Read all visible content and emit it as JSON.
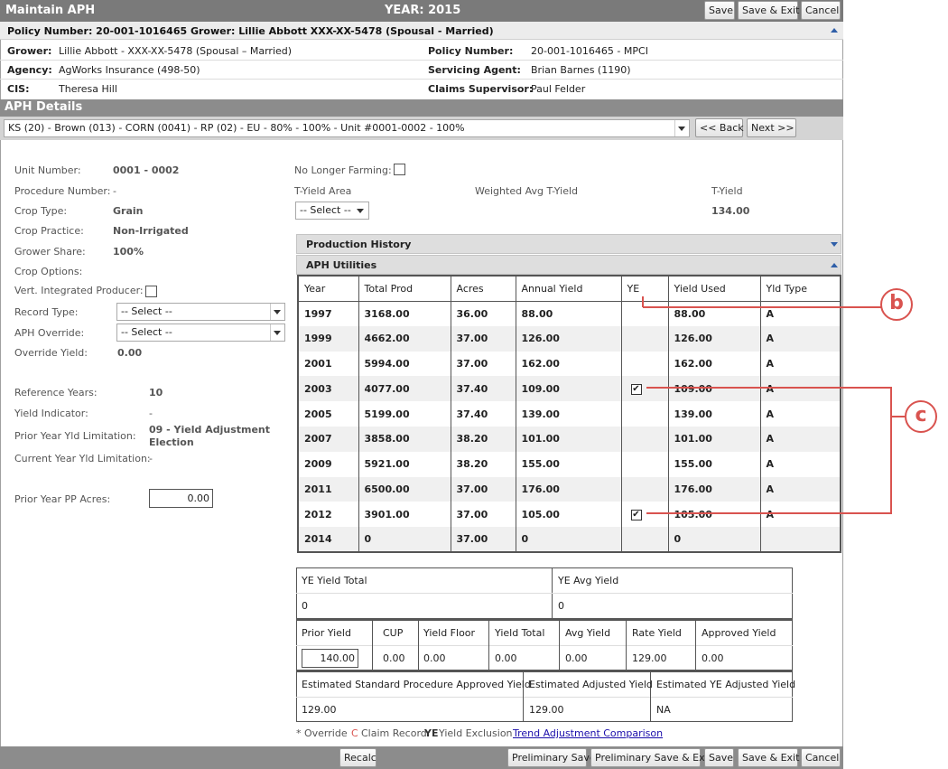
{
  "header": {
    "title": "Maintain APH",
    "year": "YEAR: 2015",
    "buttons": {
      "save": "Save",
      "save_exit": "Save & Exit",
      "cancel": "Cancel"
    }
  },
  "policy_bar": "Policy Number: 20-001-1016465 Grower: Lillie Abbott XXX-XX-5478 (Spousal - Married)",
  "info": {
    "grower_label": "Grower:",
    "grower": "Lillie Abbott - XXX-XX-5478 (Spousal – Married)",
    "agency_label": "Agency:",
    "agency": "AgWorks Insurance (498-50)",
    "cis_label": "CIS:",
    "cis": "Theresa Hill",
    "policy_label": "Policy Number:",
    "policy": "20-001-1016465 - MPCI",
    "agent_label": "Servicing Agent:",
    "agent": "Brian Barnes (1190)",
    "claims_label": "Claims Supervisor:",
    "claims": "Paul Felder"
  },
  "aph": {
    "section_title": "APH Details",
    "unit_select": "KS (20) - Brown (013) - CORN (0041) - RP (02) - EU - 80% - 100% - Unit #0001-0002 - 100%",
    "back": "<< Back",
    "next": "Next >>"
  },
  "left": {
    "unit_number_label": "Unit Number:",
    "unit_number": "0001 - 0002",
    "procedure_label": "Procedure Number:",
    "procedure": "-",
    "crop_type_label": "Crop Type:",
    "crop_type": "Grain",
    "crop_practice_label": "Crop Practice:",
    "crop_practice": "Non-Irrigated",
    "grower_share_label": "Grower Share:",
    "grower_share": "100%",
    "crop_options_label": "Crop Options:",
    "vert_label": "Vert. Integrated Producer:",
    "record_type_label": "Record Type:",
    "record_type": "-- Select --",
    "aph_override_label": "APH Override:",
    "aph_override": "-- Select --",
    "override_yield_label": "Override Yield:",
    "override_yield": "0.00",
    "ref_years_label": "Reference Years:",
    "ref_years": "10",
    "yield_ind_label": "Yield Indicator:",
    "yield_ind": "-",
    "prior_lim_label": "Prior Year Yld Limitation:",
    "prior_lim_1": "09 - Yield Adjustment",
    "prior_lim_2": "Election",
    "current_lim_label": "Current Year Yld Limitation:",
    "current_lim": "-",
    "pp_acres_label": "Prior Year PP Acres:",
    "pp_acres": "0.00"
  },
  "middle": {
    "no_longer_label": "No Longer Farming:",
    "tyield_area_label": "T-Yield Area",
    "tyield_area": "-- Select --",
    "weighted_label": "Weighted Avg T-Yield",
    "tyield_label": "T-Yield",
    "tyield": "134.00",
    "production_history": "Production History",
    "aph_utilities": "APH Utilities"
  },
  "yield_table": {
    "headers": [
      "Year",
      "Total Prod",
      "Acres",
      "Annual Yield",
      "YE",
      "Yield Used",
      "Yld Type"
    ],
    "rows": [
      {
        "year": "1997",
        "prod": "3168.00",
        "acres": "36.00",
        "annual": "88.00",
        "ye": false,
        "used": "88.00",
        "type": "A"
      },
      {
        "year": "1999",
        "prod": "4662.00",
        "acres": "37.00",
        "annual": "126.00",
        "ye": false,
        "used": "126.00",
        "type": "A"
      },
      {
        "year": "2001",
        "prod": "5994.00",
        "acres": "37.00",
        "annual": "162.00",
        "ye": false,
        "used": "162.00",
        "type": "A"
      },
      {
        "year": "2003",
        "prod": "4077.00",
        "acres": "37.40",
        "annual": "109.00",
        "ye": true,
        "used": "109.00",
        "type": "A"
      },
      {
        "year": "2005",
        "prod": "5199.00",
        "acres": "37.40",
        "annual": "139.00",
        "ye": false,
        "used": "139.00",
        "type": "A"
      },
      {
        "year": "2007",
        "prod": "3858.00",
        "acres": "38.20",
        "annual": "101.00",
        "ye": false,
        "used": "101.00",
        "type": "A"
      },
      {
        "year": "2009",
        "prod": "5921.00",
        "acres": "38.20",
        "annual": "155.00",
        "ye": false,
        "used": "155.00",
        "type": "A"
      },
      {
        "year": "2011",
        "prod": "6500.00",
        "acres": "37.00",
        "annual": "176.00",
        "ye": false,
        "used": "176.00",
        "type": "A"
      },
      {
        "year": "2012",
        "prod": "3901.00",
        "acres": "37.00",
        "annual": "105.00",
        "ye": true,
        "used": "105.00",
        "type": "A"
      },
      {
        "year": "2014",
        "prod": "0",
        "acres": "37.00",
        "annual": "0",
        "ye": false,
        "used": "0",
        "type": ""
      }
    ]
  },
  "summary": {
    "ye_total_label": "YE Yield Total",
    "ye_total": "0",
    "ye_avg_label": "YE Avg Yield",
    "ye_avg": "0",
    "prior_yield_label": "Prior Yield",
    "prior_yield": "140.00",
    "cup_label": "CUP",
    "cup": "0.00",
    "floor_label": "Yield Floor",
    "floor": "0.00",
    "yield_total_label": "Yield Total",
    "yield_total": "0.00",
    "avg_yield_label": "Avg Yield",
    "avg_yield": "0.00",
    "rate_yield_label": "Rate Yield",
    "rate_yield": "129.00",
    "approved_label": "Approved Yield",
    "approved": "0.00",
    "est_std_label": "Estimated Standard Procedure Approved Yield",
    "est_std": "129.00",
    "est_adj_label": "Estimated Adjusted Yield",
    "est_adj": "129.00",
    "est_ye_label": "Estimated YE Adjusted Yield",
    "est_ye": "NA"
  },
  "legend": {
    "override": "* Override",
    "claim_c": "C",
    "claim": "Claim Record",
    "ye_tag": "YE",
    "ye": "Yield Exclusion",
    "trend_link": "Trend Adjustment Comparison"
  },
  "footer": {
    "recalc": "Recalc",
    "prelim_save": "Preliminary Save",
    "prelim_save_exit": "Preliminary Save & Exit",
    "save": "Save",
    "save_exit": "Save & Exit",
    "cancel": "Cancel"
  },
  "callouts": {
    "b": "b",
    "c": "c"
  },
  "colors": {
    "callout": "#d9534f",
    "header_bg": "#7a7a7a",
    "link": "#1a0dab"
  }
}
